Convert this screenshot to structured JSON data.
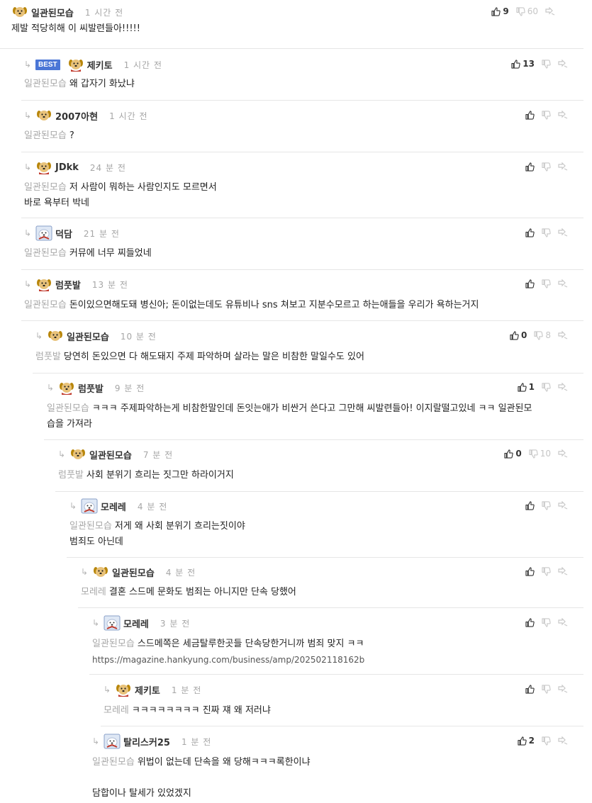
{
  "colors": {
    "best_badge": "#4a76d6",
    "nick": "#333333",
    "time": "#a6a6a6",
    "mention": "#a8a8a8",
    "divider": "#e6e6e6"
  },
  "icons": {
    "upvote": "thumbs-up-icon",
    "downvote": "thumbs-down-icon",
    "report": "report-icon",
    "reply": "reply-arrow-icon"
  },
  "comments": [
    {
      "nick": "일관된모습",
      "time": "1 시간 전",
      "avatar": "dog",
      "mention": "",
      "text": "제발 적당히해 이 씨발련들아!!!!!",
      "text2": "",
      "link": "",
      "up": "9",
      "down": "60",
      "best": ""
    },
    {
      "nick": "제키토",
      "time": "1 시간 전",
      "avatar": "dog-red",
      "mention": "일관된모습",
      "text": "왜 갑자기 화났냐",
      "text2": "",
      "link": "",
      "up": "13",
      "down": "",
      "best": "BEST"
    },
    {
      "nick": "2007아현",
      "time": "1 시간 전",
      "avatar": "dog",
      "mention": "일관된모습",
      "text": "?",
      "text2": "",
      "link": "",
      "up": "",
      "down": "",
      "best": ""
    },
    {
      "nick": "JDkk",
      "time": "24 분 전",
      "avatar": "dog-red",
      "mention": "일관된모습",
      "text": "저 사람이 뭐하는 사람인지도 모르면서",
      "text2": "바로 욕부터 박네",
      "link": "",
      "up": "",
      "down": "",
      "best": ""
    },
    {
      "nick": "덕담",
      "time": "21 분 전",
      "avatar": "polar",
      "mention": "일관된모습",
      "text": "커뮤에 너무 찌들었네",
      "text2": "",
      "link": "",
      "up": "",
      "down": "",
      "best": ""
    },
    {
      "nick": "럼풋발",
      "time": "13 분 전",
      "avatar": "dog-red",
      "mention": "일관된모습",
      "text": "돈이있으면해도돼 병신아; 돈이없는데도 유튜비나 sns 쳐보고 지분수모르고 하는애들을 우리가 욕하는거지",
      "text2": "",
      "link": "",
      "up": "",
      "down": "",
      "best": ""
    },
    {
      "nick": "일관된모습",
      "time": "10 분 전",
      "avatar": "dog",
      "mention": "럼풋발",
      "text": "당연히 돈있으면 다 해도돼지 주제 파악하며 살라는 말은 비참한 말일수도 있어",
      "text2": "",
      "link": "",
      "up": "0",
      "down": "8",
      "best": ""
    },
    {
      "nick": "럼풋발",
      "time": "9 분 전",
      "avatar": "dog-red",
      "mention": "일관된모습",
      "text": "ㅋㅋㅋ 주제파악하는게 비참한말인데 돈잇는애가 비싼거 쓴다고 그만해 씨발련들아! 이지랄떨고있네 ㅋㅋ 일관된모",
      "text2": "습을 가져라",
      "link": "",
      "up": "1",
      "down": "",
      "best": ""
    },
    {
      "nick": "일관된모습",
      "time": "7 분 전",
      "avatar": "dog",
      "mention": "럼풋발",
      "text": "사회 분위기 흐리는 짓그만 하라이거지",
      "text2": "",
      "link": "",
      "up": "0",
      "down": "10",
      "best": ""
    },
    {
      "nick": "모레레",
      "time": "4 분 전",
      "avatar": "polar",
      "mention": "일관된모습",
      "text": "저게 왜 사회 분위기 흐리는짓이야",
      "text2": "범죄도 아닌데",
      "link": "",
      "up": "",
      "down": "",
      "best": ""
    },
    {
      "nick": "일관된모습",
      "time": "4 분 전",
      "avatar": "dog",
      "mention": "모레레",
      "text": "결혼 스드메 문화도 범죄는 아니지만 단속 당했어",
      "text2": "",
      "link": "",
      "up": "",
      "down": "",
      "best": ""
    },
    {
      "nick": "모레레",
      "time": "3 분 전",
      "avatar": "polar",
      "mention": "일관된모습",
      "text": "스드메쪽은 세금탈루한곳들 단속당한거니까 범죄 맞지 ㅋㅋ",
      "text2": "",
      "link": "https://magazine.hankyung.com/business/amp/202502118162b",
      "up": "",
      "down": "",
      "best": ""
    },
    {
      "nick": "제키토",
      "time": "1 분 전",
      "avatar": "dog-red",
      "mention": "모레레",
      "text": "ㅋㅋㅋㅋㅋㅋㅋㅋ 진짜 쟤 왜 저러냐",
      "text2": "",
      "link": "",
      "up": "",
      "down": "",
      "best": ""
    },
    {
      "nick": "탈리스커25",
      "time": "1 분 전",
      "avatar": "polar",
      "mention": "일관된모습",
      "text": "위법이 없는데 단속을 왜 당해ㅋㅋㅋ록한이냐",
      "text2": "",
      "link": "",
      "up": "2",
      "down": "",
      "best": "",
      "text3": "담합이나 탈세가 있었겠지"
    }
  ]
}
